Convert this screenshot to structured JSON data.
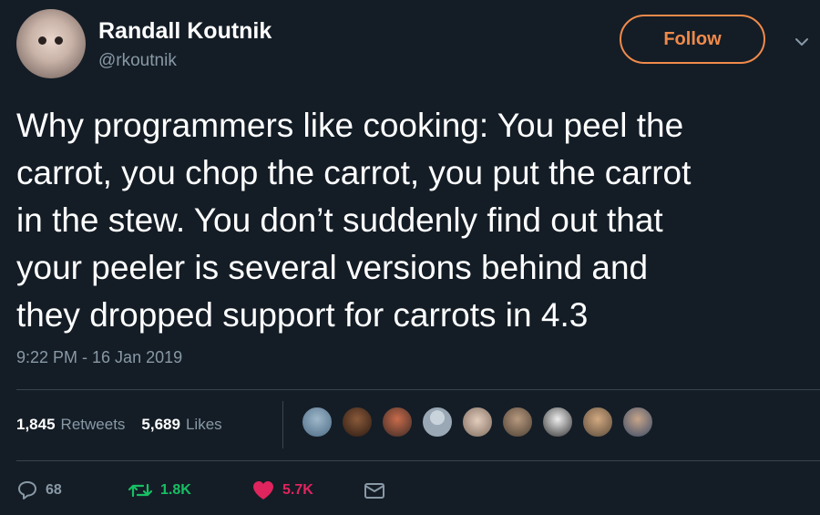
{
  "user": {
    "name": "Randall Koutnik",
    "handle": "@rkoutnik",
    "follow_label": "Follow"
  },
  "tweet": {
    "text": "Why programmers like cooking:  You peel the\ncarrot, you chop the carrot, you put the carrot\nin the stew.  You don’t suddenly find out that\nyour peeler is several versions behind and\nthey dropped support for carrots in 4.3",
    "timestamp": "9:22 PM - 16 Jan 2019"
  },
  "stats": {
    "retweets_count": "1,845",
    "retweets_label": "Retweets",
    "likes_count": "5,689",
    "likes_label": "Likes"
  },
  "actions": {
    "reply_count": "68",
    "retweet_count": "1.8K",
    "like_count": "5.7K"
  },
  "colors": {
    "background": "#141d26",
    "accent_orange": "#f08a4b",
    "muted_text": "#8899a6",
    "retweet_green": "#17bf63",
    "like_red": "#e0245e"
  },
  "icons": [
    "chevron-down-icon",
    "reply-icon",
    "retweet-icon",
    "heart-icon",
    "message-icon"
  ]
}
